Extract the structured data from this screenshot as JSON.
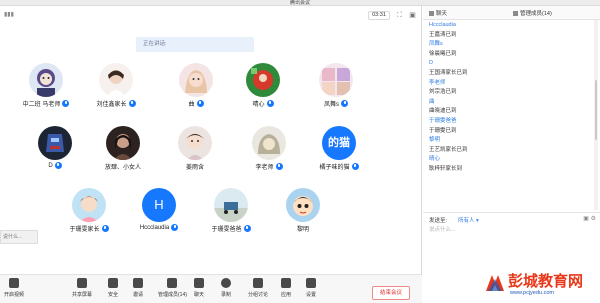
{
  "window": {
    "title": "腾讯会议"
  },
  "topbar": {
    "timer": "03:31"
  },
  "speaking": {
    "label": "正在讲话:"
  },
  "participants": [
    {
      "name": "中二班 马老师",
      "avatar": "photo",
      "mic": true
    },
    {
      "name": "刘佳鑫家长",
      "avatar": "photo",
      "mic": true
    },
    {
      "name": "曲",
      "avatar": "photo",
      "mic": true
    },
    {
      "name": "晴心",
      "avatar": "photo",
      "mic": true
    },
    {
      "name": "凤舞s",
      "avatar": "photo",
      "mic": true
    },
    {
      "name": "D",
      "avatar": "photo",
      "mic": true
    },
    {
      "name": "放肆、小女人",
      "avatar": "photo",
      "mic": false
    },
    {
      "name": "姜雨含",
      "avatar": "photo",
      "mic": false
    },
    {
      "name": "李老师",
      "avatar": "photo",
      "mic": true
    },
    {
      "name": "橘子味的猫",
      "avatar": "text",
      "avatar_text": "的猫",
      "mic": true
    },
    {
      "name": "于珊雯家长",
      "avatar": "photo",
      "mic": true
    },
    {
      "name": "Hccclaudia",
      "avatar": "text",
      "avatar_text": "H",
      "mic": true
    },
    {
      "name": "于珊雯爸爸",
      "avatar": "photo",
      "mic": true
    },
    {
      "name": "黎明",
      "avatar": "photo",
      "mic": false
    }
  ],
  "sidehint": {
    "text": "说什么..."
  },
  "toolbar": {
    "items": [
      {
        "label": "开启视频"
      },
      {
        "label": "共享屏幕"
      },
      {
        "label": "安全"
      },
      {
        "label": "邀请"
      },
      {
        "label": "管理成员(14)"
      },
      {
        "label": "聊天"
      },
      {
        "label": "录制"
      },
      {
        "label": "分组讨论"
      },
      {
        "label": "应用"
      },
      {
        "label": "设置"
      }
    ],
    "end_label": "结束会议"
  },
  "chat": {
    "tab_chat": "聊天",
    "tab_manage": "管理成员(14)",
    "messages": [
      {
        "kind": "name",
        "text": "Hccclaudia"
      },
      {
        "kind": "text",
        "text": "王嘉涛已到"
      },
      {
        "kind": "name",
        "text": "凤舞s"
      },
      {
        "kind": "text",
        "text": "徐晨曦已到"
      },
      {
        "kind": "name",
        "text": "D"
      },
      {
        "kind": "text",
        "text": "王国涛家长已到"
      },
      {
        "kind": "name",
        "text": "李老师"
      },
      {
        "kind": "text",
        "text": "刘宗浩已到"
      },
      {
        "kind": "name",
        "text": "曲"
      },
      {
        "kind": "text",
        "text": "曲晓迪已到"
      },
      {
        "kind": "name",
        "text": "于珊雯爸爸"
      },
      {
        "kind": "text",
        "text": "于珊雯已到"
      },
      {
        "kind": "name",
        "text": "黎明"
      },
      {
        "kind": "text",
        "text": "王艺凯家长已到"
      },
      {
        "kind": "name",
        "text": "晴心"
      },
      {
        "kind": "text",
        "text": "耿梓轩家长到"
      }
    ],
    "send_label": "发送至:",
    "send_to": "所有人",
    "placeholder": "说点什么..."
  },
  "watermark": {
    "brand": "彭城教育网",
    "url": "www.pcjyedu.com"
  }
}
